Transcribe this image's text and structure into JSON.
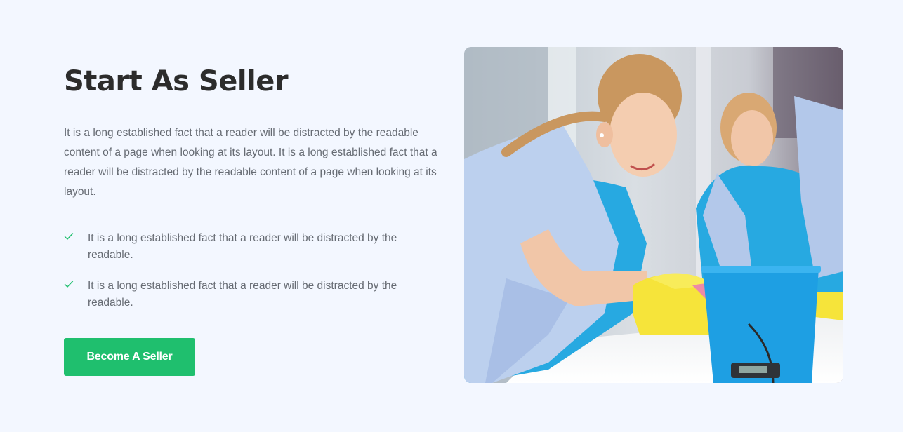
{
  "section": {
    "title": "Start As Seller",
    "description": "It is a long established fact that a reader will be distracted by the readable content of a page when looking at its layout. It is a long established fact that a reader will be distracted by the readable content of a page when looking at its layout.",
    "bullets": [
      {
        "text": "It is a long established fact that a reader will be distracted by the readable."
      },
      {
        "text": "It is a long established fact that a reader will be distracted by the readable."
      }
    ],
    "cta_label": "Become A Seller"
  },
  "image": {
    "subject": "cleaning-workers-photo"
  },
  "colors": {
    "background": "#f3f7ff",
    "accent": "#1fbf6e",
    "heading": "#2c2c2c",
    "body_text": "#666b73",
    "check": "#1fbf6e"
  }
}
